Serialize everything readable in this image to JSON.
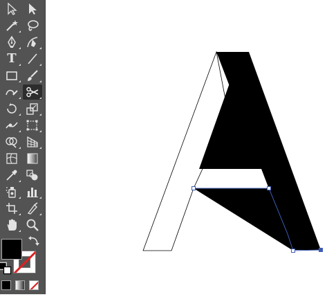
{
  "toolbar": {
    "tools": [
      {
        "name": "selection-tool",
        "icon": "selection-arrow-icon",
        "selected": false
      },
      {
        "name": "direct-selection-tool",
        "icon": "direct-selection-arrow-icon",
        "selected": false
      },
      {
        "name": "magic-wand-tool",
        "icon": "magic-wand-icon",
        "selected": false
      },
      {
        "name": "lasso-tool",
        "icon": "lasso-icon",
        "selected": false
      },
      {
        "name": "pen-tool",
        "icon": "pen-icon",
        "selected": false
      },
      {
        "name": "curvature-tool",
        "icon": "curvature-pen-icon",
        "selected": false
      },
      {
        "name": "type-tool",
        "icon": "type-icon",
        "selected": false
      },
      {
        "name": "line-segment-tool",
        "icon": "line-segment-icon",
        "selected": false
      },
      {
        "name": "rectangle-tool",
        "icon": "rectangle-icon",
        "selected": false
      },
      {
        "name": "paintbrush-tool",
        "icon": "paintbrush-icon",
        "selected": false
      },
      {
        "name": "shaper-tool",
        "icon": "shaper-icon",
        "selected": false
      },
      {
        "name": "scissors-tool",
        "icon": "scissors-icon",
        "selected": true
      },
      {
        "name": "rotate-tool",
        "icon": "rotate-icon",
        "selected": false
      },
      {
        "name": "scale-tool",
        "icon": "scale-icon",
        "selected": false
      },
      {
        "name": "warp-tool",
        "icon": "warp-icon",
        "selected": false
      },
      {
        "name": "free-transform-tool",
        "icon": "free-transform-icon",
        "selected": false
      },
      {
        "name": "shape-builder-tool",
        "icon": "shape-builder-icon",
        "selected": false
      },
      {
        "name": "perspective-grid-tool",
        "icon": "perspective-grid-icon",
        "selected": false
      },
      {
        "name": "mesh-tool",
        "icon": "mesh-icon",
        "selected": false
      },
      {
        "name": "gradient-tool",
        "icon": "gradient-icon",
        "selected": false
      },
      {
        "name": "eyedropper-tool",
        "icon": "eyedropper-icon",
        "selected": false
      },
      {
        "name": "blend-tool",
        "icon": "blend-icon",
        "selected": false
      },
      {
        "name": "symbol-sprayer-tool",
        "icon": "symbol-sprayer-icon",
        "selected": false
      },
      {
        "name": "column-graph-tool",
        "icon": "column-graph-icon",
        "selected": false
      },
      {
        "name": "artboard-tool",
        "icon": "artboard-icon",
        "selected": false
      },
      {
        "name": "slice-tool",
        "icon": "slice-icon",
        "selected": false
      },
      {
        "name": "hand-tool",
        "icon": "hand-icon",
        "selected": false
      },
      {
        "name": "zoom-tool",
        "icon": "zoom-icon",
        "selected": false
      }
    ],
    "type_tool_glyph": "T",
    "fill_color": "#000000",
    "stroke_color": "none",
    "panel_color": "#535353",
    "selected_color": "#2d2d2d"
  },
  "canvas": {
    "background": "#ffffff",
    "selection_color": "#3d5bb3",
    "letterform": "A"
  }
}
